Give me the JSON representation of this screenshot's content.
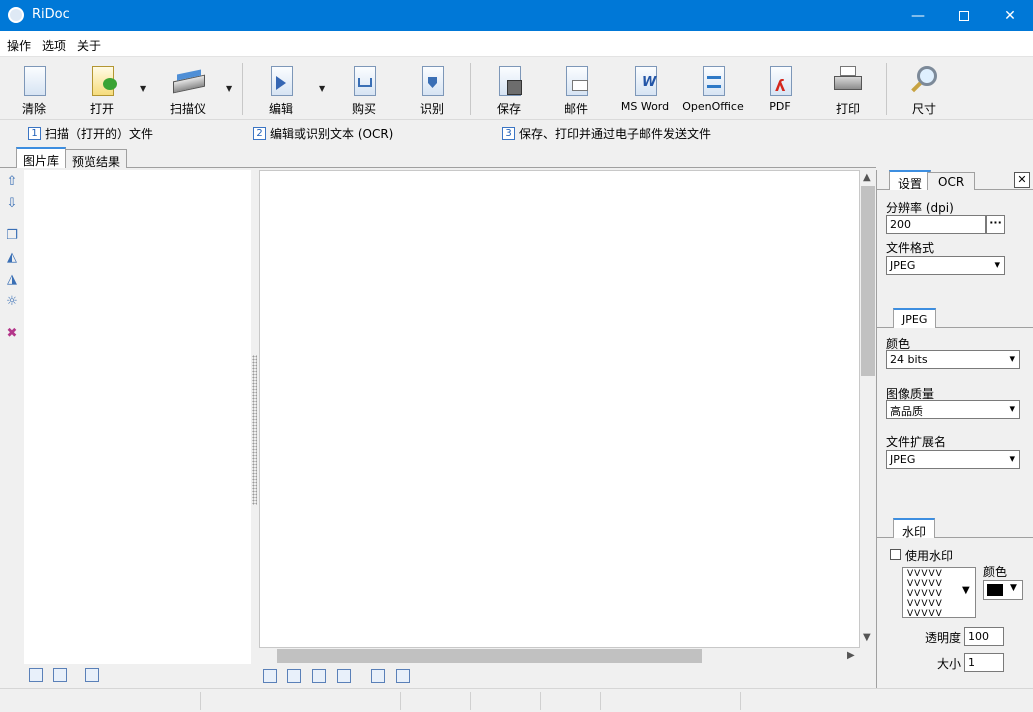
{
  "window": {
    "title": "RiDoc"
  },
  "menu": [
    "操作",
    "选项",
    "关于"
  ],
  "toolbar": {
    "clear": "清除",
    "open": "打开",
    "scanner": "扫描仪",
    "edit": "编辑",
    "buy": "购买",
    "recognize": "识别",
    "save": "保存",
    "mail": "邮件",
    "msword": "MS Word",
    "openoffice": "OpenOffice",
    "pdf": "PDF",
    "print": "打印",
    "size": "尺寸"
  },
  "steps": [
    {
      "num": "1",
      "text": "扫描（打开的）文件"
    },
    {
      "num": "2",
      "text": "编辑或识别文本 (OCR)"
    },
    {
      "num": "3",
      "text": "保存、打印并通过电子邮件发送文件"
    }
  ],
  "left_tabs": [
    "图片库",
    "预览结果"
  ],
  "right_tabs": [
    "设置",
    "OCR"
  ],
  "settings": {
    "resolution_label": "分辨率 (dpi)",
    "resolution_value": "200",
    "format_label": "文件格式",
    "format_value": "JPEG",
    "jpeg_tab": "JPEG",
    "color_label": "颜色",
    "color_value": "24 bits",
    "quality_label": "图像质量",
    "quality_value": "高品质",
    "ext_label": "文件扩展名",
    "ext_value": "JPEG",
    "watermark_tab": "水印",
    "use_watermark": "使用水印",
    "watermark_color_label": "颜色",
    "watermark_pattern": "VVVVV",
    "transparency_label": "透明度",
    "transparency_value": "100",
    "size_label": "大小",
    "size_value": "1",
    "more_button": "···"
  },
  "colors": {
    "titlebar": "#0078d7",
    "accent_tab": "#3d8ee0",
    "watermark_color": "#000000"
  }
}
